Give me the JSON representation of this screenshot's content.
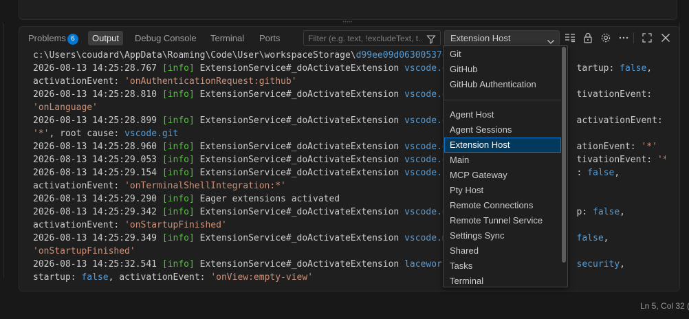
{
  "panel": {
    "tabs": [
      {
        "label": "Problems",
        "badge": "6"
      },
      {
        "label": "Output"
      },
      {
        "label": "Debug Console"
      },
      {
        "label": "Terminal"
      },
      {
        "label": "Ports"
      }
    ],
    "filter": {
      "placeholder": "Filter (e.g. text, !excludeText, t..."
    },
    "channel_select": {
      "value": "Extension Host"
    },
    "icons": [
      "filter-icon",
      "chevron-down-icon",
      "list-filter-icon",
      "lock-icon",
      "gear-icon",
      "more-icon",
      "maximize-icon",
      "close-icon"
    ]
  },
  "log": {
    "lines": [
      [
        {
          "t": "c:\\Users\\coudard\\AppData\\Roaming\\Code\\User\\workspaceStorage\\",
          "c": "ts"
        },
        {
          "t": "d99ee09d06300537e4",
          "c": "ext"
        }
      ],
      [
        {
          "t": "2026-08-13 14:25:28.767 ",
          "c": "ts"
        },
        {
          "t": "[info]",
          "c": "lvl"
        },
        {
          "t": " ExtensionService#_doActivateExtension ",
          "c": "ts"
        },
        {
          "t": "vscode.gi",
          "c": "ext"
        },
        {
          "t": "                       ",
          "c": "ts"
        },
        {
          "t": "tartup: ",
          "c": "ts"
        },
        {
          "t": "false",
          "c": "kw"
        },
        {
          "t": ",",
          "c": "ts"
        }
      ],
      [
        {
          "t": "activationEvent: ",
          "c": "ts"
        },
        {
          "t": "'onAuthenticationRequest:github'",
          "c": "str"
        }
      ],
      [
        {
          "t": "2026-08-13 14:25:28.810 ",
          "c": "ts"
        },
        {
          "t": "[info]",
          "c": "lvl"
        },
        {
          "t": " ExtensionService#_doActivateExtension ",
          "c": "ts"
        },
        {
          "t": "vscode.en",
          "c": "ext"
        },
        {
          "t": "                       ",
          "c": "ts"
        },
        {
          "t": "tivationEvent:",
          "c": "ts"
        }
      ],
      [
        {
          "t": "'onLanguage'",
          "c": "str"
        }
      ],
      [
        {
          "t": "2026-08-13 14:25:28.899 ",
          "c": "ts"
        },
        {
          "t": "[info]",
          "c": "lvl"
        },
        {
          "t": " ExtensionService#_doActivateExtension ",
          "c": "ts"
        },
        {
          "t": "vscode.gi",
          "c": "ext"
        },
        {
          "t": "                       ",
          "c": "ts"
        },
        {
          "t": "activationEvent:",
          "c": "ts"
        }
      ],
      [
        {
          "t": "'*'",
          "c": "str"
        },
        {
          "t": ", root cause: ",
          "c": "ts"
        },
        {
          "t": "vscode.git",
          "c": "ext"
        }
      ],
      [
        {
          "t": "2026-08-13 14:25:28.960 ",
          "c": "ts"
        },
        {
          "t": "[info]",
          "c": "lvl"
        },
        {
          "t": " ExtensionService#_doActivateExtension ",
          "c": "ts"
        },
        {
          "t": "vscode.gi",
          "c": "ext"
        },
        {
          "t": "                       ",
          "c": "ts"
        },
        {
          "t": "ationEvent: ",
          "c": "ts"
        },
        {
          "t": "'*'",
          "c": "str"
        }
      ],
      [
        {
          "t": "2026-08-13 14:25:29.053 ",
          "c": "ts"
        },
        {
          "t": "[info]",
          "c": "lvl"
        },
        {
          "t": " ExtensionService#_doActivateExtension ",
          "c": "ts"
        },
        {
          "t": "vscode.gi",
          "c": "ext"
        },
        {
          "t": "                       ",
          "c": "ts"
        },
        {
          "t": "tivationEvent: ",
          "c": "ts"
        },
        {
          "t": "'*'",
          "c": "str"
        }
      ],
      [
        {
          "t": "2026-08-13 14:25:29.154 ",
          "c": "ts"
        },
        {
          "t": "[info]",
          "c": "lvl"
        },
        {
          "t": " ExtensionService#_doActivateExtension ",
          "c": "ts"
        },
        {
          "t": "vscode.te",
          "c": "ext"
        },
        {
          "t": "                       ",
          "c": "ts"
        },
        {
          "t": ": ",
          "c": "ts"
        },
        {
          "t": "false",
          "c": "kw"
        },
        {
          "t": ",",
          "c": "ts"
        }
      ],
      [
        {
          "t": "activationEvent: ",
          "c": "ts"
        },
        {
          "t": "'onTerminalShellIntegration:*'",
          "c": "str"
        }
      ],
      [
        {
          "t": "2026-08-13 14:25:29.290 ",
          "c": "ts"
        },
        {
          "t": "[info]",
          "c": "lvl"
        },
        {
          "t": " Eager extensions activated",
          "c": "ts"
        }
      ],
      [
        {
          "t": "2026-08-13 14:25:29.342 ",
          "c": "ts"
        },
        {
          "t": "[info]",
          "c": "lvl"
        },
        {
          "t": " ExtensionService#_doActivateExtension ",
          "c": "ts"
        },
        {
          "t": "vscode.de",
          "c": "ext"
        },
        {
          "t": "                       ",
          "c": "ts"
        },
        {
          "t": "p: ",
          "c": "ts"
        },
        {
          "t": "false",
          "c": "kw"
        },
        {
          "t": ",",
          "c": "ts"
        }
      ],
      [
        {
          "t": "activationEvent: ",
          "c": "ts"
        },
        {
          "t": "'onStartupFinished'",
          "c": "str"
        }
      ],
      [
        {
          "t": "2026-08-13 14:25:29.349 ",
          "c": "ts"
        },
        {
          "t": "[info]",
          "c": "lvl"
        },
        {
          "t": " ExtensionService#_doActivateExtension ",
          "c": "ts"
        },
        {
          "t": "vscode.me",
          "c": "ext"
        },
        {
          "t": "                       ",
          "c": "ts"
        },
        {
          "t": "false",
          "c": "kw"
        },
        {
          "t": ",",
          "c": "ts"
        }
      ],
      [
        {
          "t": "'onStartupFinished'",
          "c": "str"
        }
      ],
      [
        {
          "t": "2026-08-13 14:25:32.541 ",
          "c": "ts"
        },
        {
          "t": "[info]",
          "c": "lvl"
        },
        {
          "t": " ExtensionService#_doActivateExtension ",
          "c": "ts"
        },
        {
          "t": "lacework-",
          "c": "ext"
        },
        {
          "t": "                       ",
          "c": "ts"
        },
        {
          "t": "security",
          "c": "ext"
        },
        {
          "t": ",",
          "c": "ts"
        }
      ],
      [
        {
          "t": "startup: ",
          "c": "ts"
        },
        {
          "t": "false",
          "c": "kw"
        },
        {
          "t": ", activationEvent: ",
          "c": "ts"
        },
        {
          "t": "'onView:empty-view'",
          "c": "str"
        }
      ]
    ]
  },
  "dropdown": {
    "group1": [
      "Git",
      "GitHub",
      "GitHub Authentication"
    ],
    "group2": [
      "Agent Host",
      "Agent Sessions",
      "Extension Host",
      "Main",
      "MCP Gateway",
      "Pty Host",
      "Remote Connections",
      "Remote Tunnel Service",
      "Settings Sync",
      "Shared",
      "Tasks",
      "Terminal"
    ],
    "selected": "Extension Host"
  },
  "status": {
    "cursor": "Ln 5, Col 32 ("
  },
  "colors": {
    "accent": "#0078d4",
    "selected_bg": "#04395e",
    "info": "#4ec936",
    "string": "#ce9178",
    "link": "#569cd6"
  }
}
